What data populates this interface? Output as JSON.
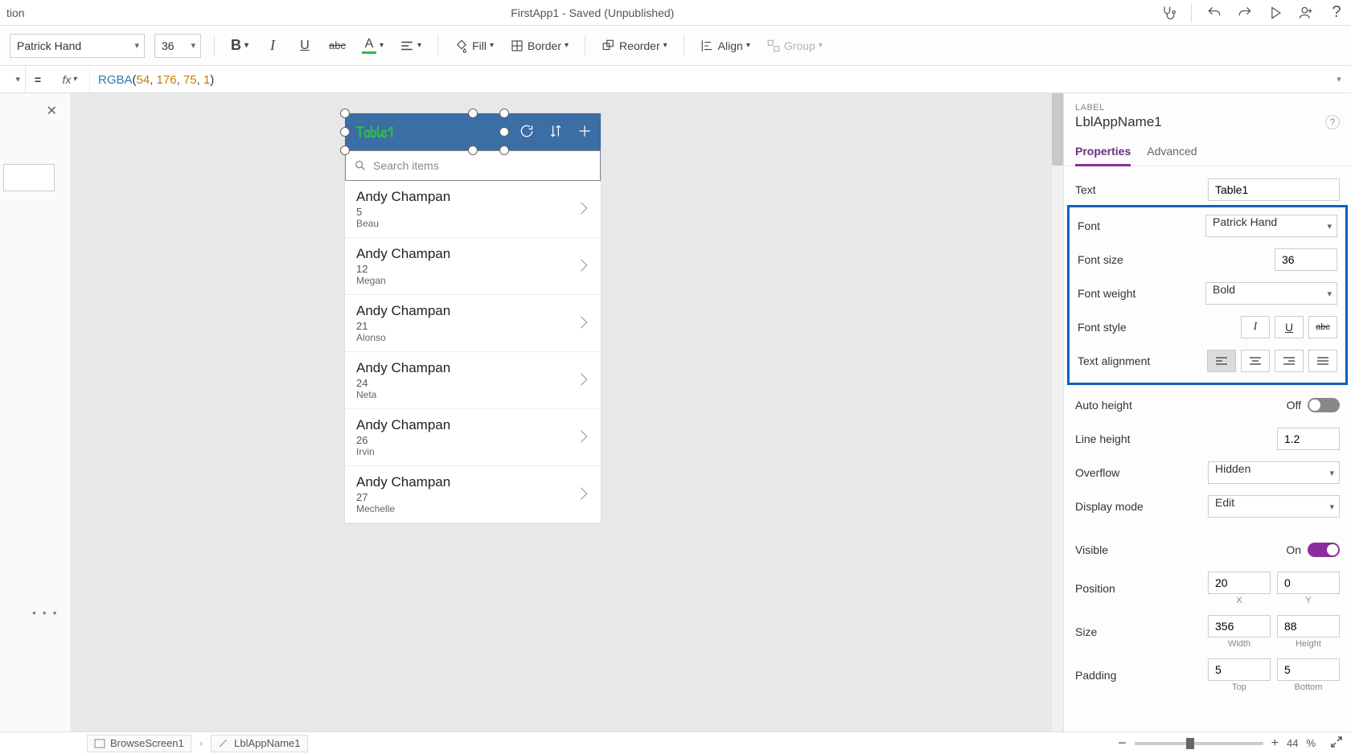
{
  "titlebar": {
    "left_fragment": "tion",
    "title": "FirstApp1 - Saved (Unpublished)"
  },
  "ribbon": {
    "font": "Patrick Hand",
    "font_size": "36",
    "fill_label": "Fill",
    "border_label": "Border",
    "reorder_label": "Reorder",
    "align_label": "Align",
    "group_label": "Group"
  },
  "formula": {
    "fn": "RGBA",
    "args": [
      "54",
      "176",
      "75",
      "1"
    ]
  },
  "canvas": {
    "title": "Table1",
    "search_placeholder": "Search items",
    "items": [
      {
        "name": "Andy Champan",
        "num": "5",
        "sub": "Beau"
      },
      {
        "name": "Andy Champan",
        "num": "12",
        "sub": "Megan"
      },
      {
        "name": "Andy Champan",
        "num": "21",
        "sub": "Alonso"
      },
      {
        "name": "Andy Champan",
        "num": "24",
        "sub": "Neta"
      },
      {
        "name": "Andy Champan",
        "num": "26",
        "sub": "Irvin"
      },
      {
        "name": "Andy Champan",
        "num": "27",
        "sub": "Mechelle"
      }
    ]
  },
  "properties": {
    "type_label": "LABEL",
    "control_name": "LblAppName1",
    "tab_props": "Properties",
    "tab_adv": "Advanced",
    "rows": {
      "text_lbl": "Text",
      "text_val": "Table1",
      "font_lbl": "Font",
      "font_val": "Patrick Hand",
      "fsize_lbl": "Font size",
      "fsize_val": "36",
      "fweight_lbl": "Font weight",
      "fweight_val": "Bold",
      "fstyle_lbl": "Font style",
      "talign_lbl": "Text alignment",
      "aheight_lbl": "Auto height",
      "aheight_val": "Off",
      "lheight_lbl": "Line height",
      "lheight_val": "1.2",
      "overflow_lbl": "Overflow",
      "overflow_val": "Hidden",
      "dmode_lbl": "Display mode",
      "dmode_val": "Edit",
      "visible_lbl": "Visible",
      "visible_val": "On",
      "pos_lbl": "Position",
      "pos_x": "20",
      "pos_y": "0",
      "x_lbl": "X",
      "y_lbl": "Y",
      "size_lbl": "Size",
      "size_w": "356",
      "size_h": "88",
      "w_lbl": "Width",
      "h_lbl": "Height",
      "pad_lbl": "Padding",
      "pad_t": "5",
      "pad_b": "5",
      "t_lbl": "Top",
      "b_lbl": "Bottom"
    }
  },
  "bottombar": {
    "bc1": "BrowseScreen1",
    "bc2": "LblAppName1",
    "zoom": "44",
    "pct": "%"
  }
}
